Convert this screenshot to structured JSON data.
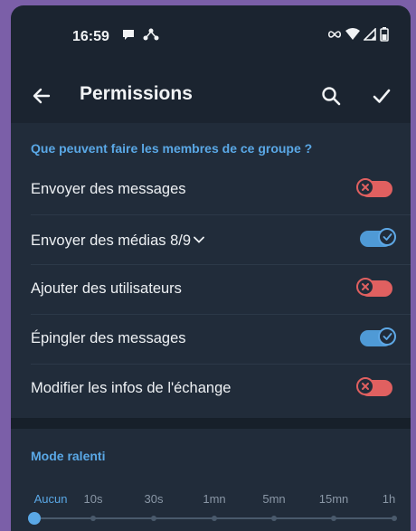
{
  "status_bar": {
    "time": "16:59",
    "left_icons": [
      "chat-bubble-icon",
      "network-activity-icon"
    ],
    "right_icons": [
      "infinity-icon",
      "wifi-icon",
      "signal-icon",
      "battery-icon"
    ]
  },
  "toolbar": {
    "title": "Permissions",
    "icons": [
      "back-arrow-icon",
      "search-icon",
      "check-icon"
    ]
  },
  "permissions": {
    "header": "Que peuvent faire les membres de ce groupe ?",
    "items": [
      {
        "label": "Envoyer des messages",
        "enabled": false
      },
      {
        "label": "Envoyer des médias 8/9",
        "enabled": true,
        "expandable": true
      },
      {
        "label": "Ajouter des utilisateurs",
        "enabled": false
      },
      {
        "label": "Épingler des messages",
        "enabled": true
      },
      {
        "label": "Modifier les infos de l'échange",
        "enabled": false
      }
    ]
  },
  "slow_mode": {
    "header": "Mode ralenti",
    "options": [
      "Aucun",
      "10s",
      "30s",
      "1mn",
      "5mn",
      "15mn",
      "1h"
    ],
    "selected": "Aucun"
  },
  "colors": {
    "accent": "#5aa8e6",
    "toggle_off": "#e06060",
    "toggle_on": "#4f9ad6",
    "background": "#1b2430",
    "section": "#212c3a"
  }
}
